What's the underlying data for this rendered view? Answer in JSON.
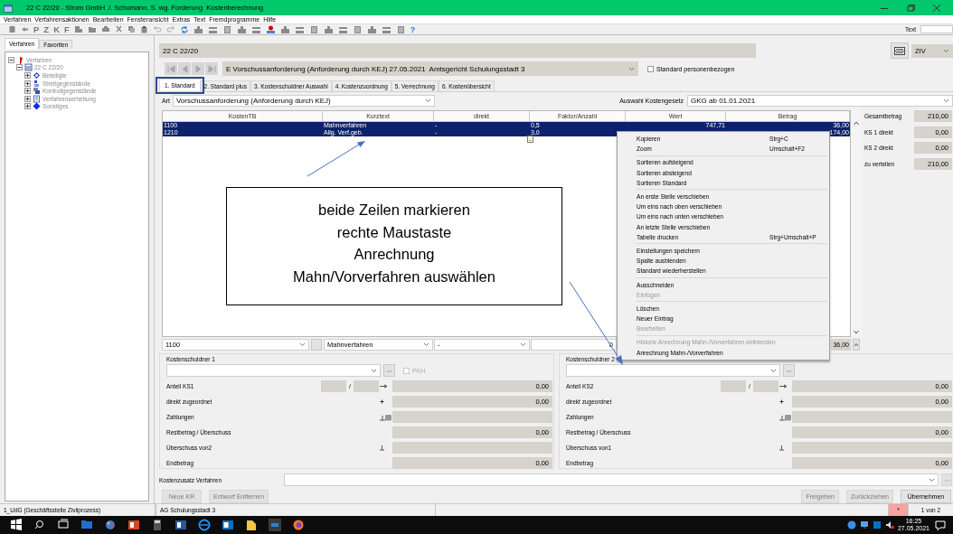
{
  "window": {
    "title": "22 C 22/20 - Strom GmbH ./. Schumann, S. wg. Forderung  Kostenberechnung"
  },
  "menu": [
    "Verfahren",
    "Verfahrensaktionen",
    "Bearbeiten",
    "Fensteransicht",
    "Extras",
    "Text",
    "Fremdprogramme",
    "Hilfe"
  ],
  "toolbar": {
    "letters": [
      "P",
      "Z",
      "K",
      "F"
    ],
    "help": "?",
    "text_label": "Text"
  },
  "sidebar": {
    "tabs": [
      {
        "label": "Verfahren",
        "selected": true
      },
      {
        "label": "Favoriten",
        "selected": false
      }
    ],
    "tree": [
      {
        "label": "Verfahren",
        "kind": "pin",
        "expanded": true,
        "children": [
          {
            "label": "22 C 22/20",
            "kind": "file",
            "expanded": true,
            "children": [
              {
                "label": "Beteiligte",
                "kind": "people",
                "expanded": false
              },
              {
                "label": "Streitgegenstände",
                "kind": "items",
                "expanded": false
              },
              {
                "label": "Kontrollgegenstände",
                "kind": "control",
                "expanded": false
              },
              {
                "label": "Verfahrenserhebung",
                "kind": "form",
                "expanded": false
              },
              {
                "label": "Sonstiges",
                "kind": "diamond",
                "expanded": false
              }
            ]
          }
        ]
      }
    ]
  },
  "header": {
    "case_number": "22 C 22/20",
    "division": "ZIV",
    "record": "E Vorschussanforderung (Anforderung durch KEJ) 27.05.2021  Amtsgericht Schulungsstadt 3",
    "standard_personenbezogen": {
      "label": "Standard personenbezogen",
      "checked": false
    }
  },
  "tabs": [
    {
      "label": "1. Standard",
      "selected": true
    },
    {
      "label": "2. Standard plus",
      "selected": false
    },
    {
      "label": "3. Kostenschuldner Auswahl",
      "selected": false
    },
    {
      "label": "4. Kostenzuordnung",
      "selected": false
    },
    {
      "label": "5. Verrechnung",
      "selected": false
    },
    {
      "label": "6. Kostenübersicht",
      "selected": false
    }
  ],
  "art": {
    "label": "Art",
    "value": "Vorschussanforderung (Anforderung durch KEJ)"
  },
  "kostengesetz": {
    "label": "Auswahl Kostengesetz",
    "value": "GKG ab 01.01.2021"
  },
  "table": {
    "columns": [
      "KostenTB",
      "Kurztext",
      "direkt",
      "Faktor/Anzahl",
      "Wert",
      "Betrag"
    ],
    "rows": [
      {
        "selected": true,
        "cells": [
          "1100",
          "Mahnverfahren",
          "-",
          "0,5",
          "747,71",
          "36,00"
        ]
      },
      {
        "selected": true,
        "cells": [
          "1210",
          "Allg. Verf.geb.",
          "-",
          "3,0",
          null,
          "174,00"
        ]
      }
    ],
    "tooltip": "-"
  },
  "summary": [
    {
      "label": "Gesamtbetrag",
      "value": "210,00"
    },
    {
      "label": "KS 1 direkt",
      "value": "0,00"
    },
    {
      "label": "KS 2 direkt",
      "value": "0,00"
    },
    {
      "label": "zu verteilen",
      "value": "210,00"
    }
  ],
  "edit_row": {
    "kosten_tb": "1100",
    "kurztext": "Mahnverfahren",
    "direkt": "-",
    "faktor": "0",
    "betrag": "36,00"
  },
  "debtors": [
    {
      "title": "Kostenschuldner 1",
      "pkh": {
        "label": "PKH",
        "checked": false
      },
      "rows": [
        {
          "label": "Anteil KS1",
          "kind": "share",
          "separator": "/",
          "value": "0,00"
        },
        {
          "label": "direkt zugeordnet",
          "kind": "plus",
          "value": "0,00"
        },
        {
          "label": "Zahlungen",
          "kind": "payments"
        },
        {
          "label": "Restbetrag / Überschuss",
          "kind": "plain",
          "value": "0,00"
        },
        {
          "label": "Überschuss von2",
          "kind": "transfer"
        },
        {
          "label": "Endbetrag",
          "kind": "plain",
          "value": "0,00"
        }
      ]
    },
    {
      "title": "Kostenschuldner 2",
      "rows": [
        {
          "label": "Anteil KS2",
          "kind": "share",
          "separator": "/",
          "value": "0,00"
        },
        {
          "label": "direkt zugeordnet",
          "kind": "plus",
          "value": "0,00"
        },
        {
          "label": "Zahlungen",
          "kind": "payments"
        },
        {
          "label": "Restbetrag / Überschuss",
          "kind": "plain",
          "value": "0,00"
        },
        {
          "label": "Überschuss von1",
          "kind": "transfer"
        },
        {
          "label": "Endbetrag",
          "kind": "plain",
          "value": "0,00"
        }
      ]
    }
  ],
  "kostenzusatz": {
    "label": "Kostenzusatz Verfahren"
  },
  "buttons_left": [
    {
      "label": "Neue KR",
      "disabled": true
    },
    {
      "label": "Entwurf Entfernen",
      "disabled": true
    }
  ],
  "buttons_right": [
    {
      "label": "Freigeben",
      "disabled": true
    },
    {
      "label": "Zurückziehen",
      "disabled": true
    },
    {
      "label": "Übernehmen",
      "disabled": false
    }
  ],
  "status_bar": {
    "user": "1_UdG (Geschäftsstelle Zivilprozess)",
    "court": "AG Schulungsstadt 3",
    "modified": "*",
    "page": "1 von 2"
  },
  "taskbar": {
    "time": "16:25",
    "date": "27.05.2021"
  },
  "context_menu": {
    "groups": [
      [
        {
          "label": "Kopieren",
          "shortcut": "Strg+C",
          "disabled": false
        },
        {
          "label": "Zoom",
          "shortcut": "Umschalt+F2",
          "disabled": false
        }
      ],
      [
        {
          "label": "Sortieren aufsteigend",
          "disabled": false
        },
        {
          "label": "Sortieren absteigend",
          "disabled": false
        },
        {
          "label": "Sortieren Standard",
          "disabled": false
        }
      ],
      [
        {
          "label": "An erste Stelle verschieben",
          "disabled": false
        },
        {
          "label": "Um eins nach oben verschieben",
          "disabled": false
        },
        {
          "label": "Um eins nach unten verschieben",
          "disabled": false
        },
        {
          "label": "An letzte Stelle verschieben",
          "disabled": false
        },
        {
          "label": "Tabelle drucken",
          "shortcut": "Strg+Umschalt+P",
          "disabled": false
        }
      ],
      [
        {
          "label": "Einstellungen speichern",
          "disabled": false
        },
        {
          "label": "Spalte ausblenden",
          "disabled": false
        },
        {
          "label": "Standard wiederherstellen",
          "disabled": false
        }
      ],
      [
        {
          "label": "Ausschneiden",
          "disabled": false
        },
        {
          "label": "Einfügen",
          "disabled": true
        }
      ],
      [
        {
          "label": "Löschen",
          "disabled": false
        },
        {
          "label": "Neuer Eintrag",
          "disabled": false
        },
        {
          "label": "Bearbeiten",
          "disabled": true
        }
      ],
      [
        {
          "label": "Historie Anrechnung Mahn-/Vorverfahren einblenden",
          "disabled": true
        },
        {
          "label": "Anrechnung Mahn-/Vorverfahren",
          "disabled": false
        }
      ]
    ]
  },
  "annotation": {
    "text": "beide Zeilen markieren\nrechte Maustaste\nAnrechnung\nMahn/Vorverfahren auswählen"
  }
}
